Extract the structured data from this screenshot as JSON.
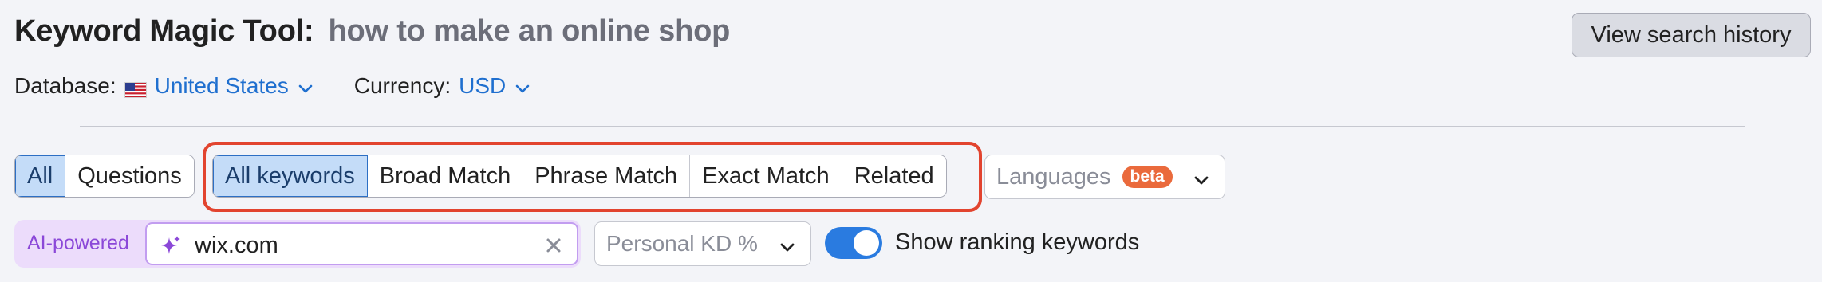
{
  "header": {
    "title": "Keyword Magic Tool:",
    "query": "how to make an online shop",
    "history_button": "View search history"
  },
  "meta": {
    "database_label": "Database:",
    "database_value": "United States",
    "currency_label": "Currency:",
    "currency_value": "USD"
  },
  "type_tabs": [
    {
      "label": "All",
      "active": true
    },
    {
      "label": "Questions",
      "active": false
    }
  ],
  "match_tabs": [
    {
      "label": "All keywords",
      "active": true
    },
    {
      "label": "Broad Match",
      "active": false
    },
    {
      "label": "Phrase Match",
      "active": false
    },
    {
      "label": "Exact Match",
      "active": false
    },
    {
      "label": "Related",
      "active": false
    }
  ],
  "languages": {
    "placeholder": "Languages",
    "badge": "beta"
  },
  "ai": {
    "label": "AI-powered",
    "value": "wix.com"
  },
  "kd": {
    "placeholder": "Personal KD %"
  },
  "ranking": {
    "label": "Show ranking keywords",
    "enabled": true
  },
  "colors": {
    "accent": "#2a7be0",
    "highlight": "#e2442f",
    "beta": "#ea6a3c",
    "ai": "#8b48d8"
  }
}
